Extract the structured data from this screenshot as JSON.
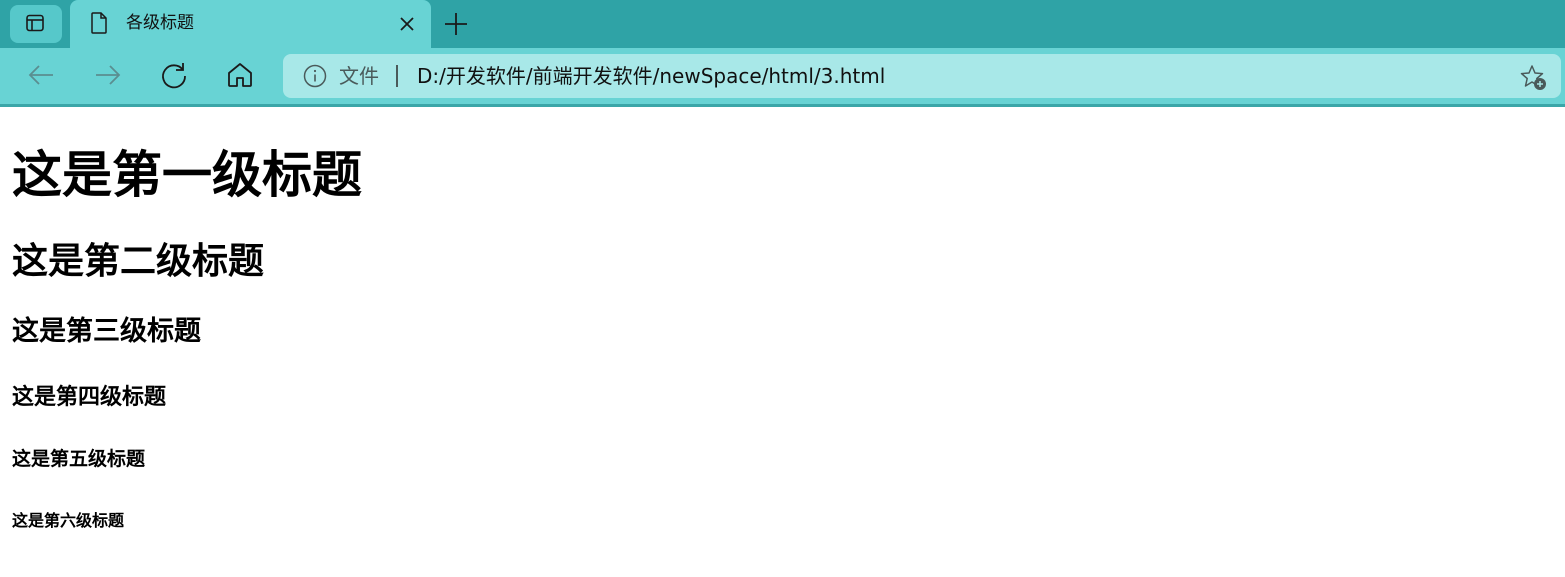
{
  "browser": {
    "tab": {
      "title": "各级标题"
    },
    "address_bar": {
      "site_label": "文件",
      "url": "D:/开发软件/前端开发软件/newSpace/html/3.html"
    },
    "icons": {
      "tab_actions": "tab-actions-icon",
      "page": "page-icon",
      "close": "close-icon",
      "new_tab": "plus-icon",
      "back": "back-arrow-icon",
      "forward": "forward-arrow-icon",
      "refresh": "refresh-icon",
      "home": "home-icon",
      "info": "info-icon",
      "favorite": "add-favorite-icon"
    },
    "colors": {
      "tabstrip": "#2fa3a6",
      "toolbar": "#68d3d4",
      "address_bar": "#a8e8e8"
    }
  },
  "page": {
    "headings": {
      "h1": "这是第一级标题",
      "h2": "这是第二级标题",
      "h3": "这是第三级标题",
      "h4": "这是第四级标题",
      "h5": "这是第五级标题",
      "h6": "这是第六级标题"
    }
  }
}
